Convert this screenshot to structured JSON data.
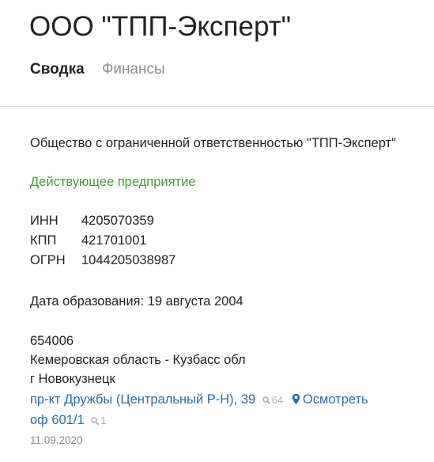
{
  "header": {
    "title": "ООО \"ТПП-Эксперт\"",
    "tabs": [
      {
        "label": "Сводка",
        "active": true
      },
      {
        "label": "Финансы",
        "active": false
      }
    ]
  },
  "company": {
    "full_name": "Общество с ограниченной ответственностью \"ТПП-Эксперт\"",
    "status": "Действующее предприятие",
    "status_color": "#4a9a3a",
    "identifiers": [
      {
        "label": "ИНН",
        "value": "4205070359"
      },
      {
        "label": "КПП",
        "value": "421701001"
      },
      {
        "label": "ОГРН",
        "value": "1044205038987"
      }
    ],
    "founded": "Дата образования: 19 августа 2004"
  },
  "address": {
    "postcode": "654006",
    "region": "Кемеровская область - Кузбасс обл",
    "city": "г Новокузнецк",
    "street": "пр-кт Дружбы (Центральный Р-Н), 39",
    "street_search_count": "64",
    "view_label": "Осмотреть",
    "office": "оф 601/1",
    "office_search_count": "1",
    "link_color": "#2e6ca8"
  },
  "updated_date": "11.09.2020"
}
